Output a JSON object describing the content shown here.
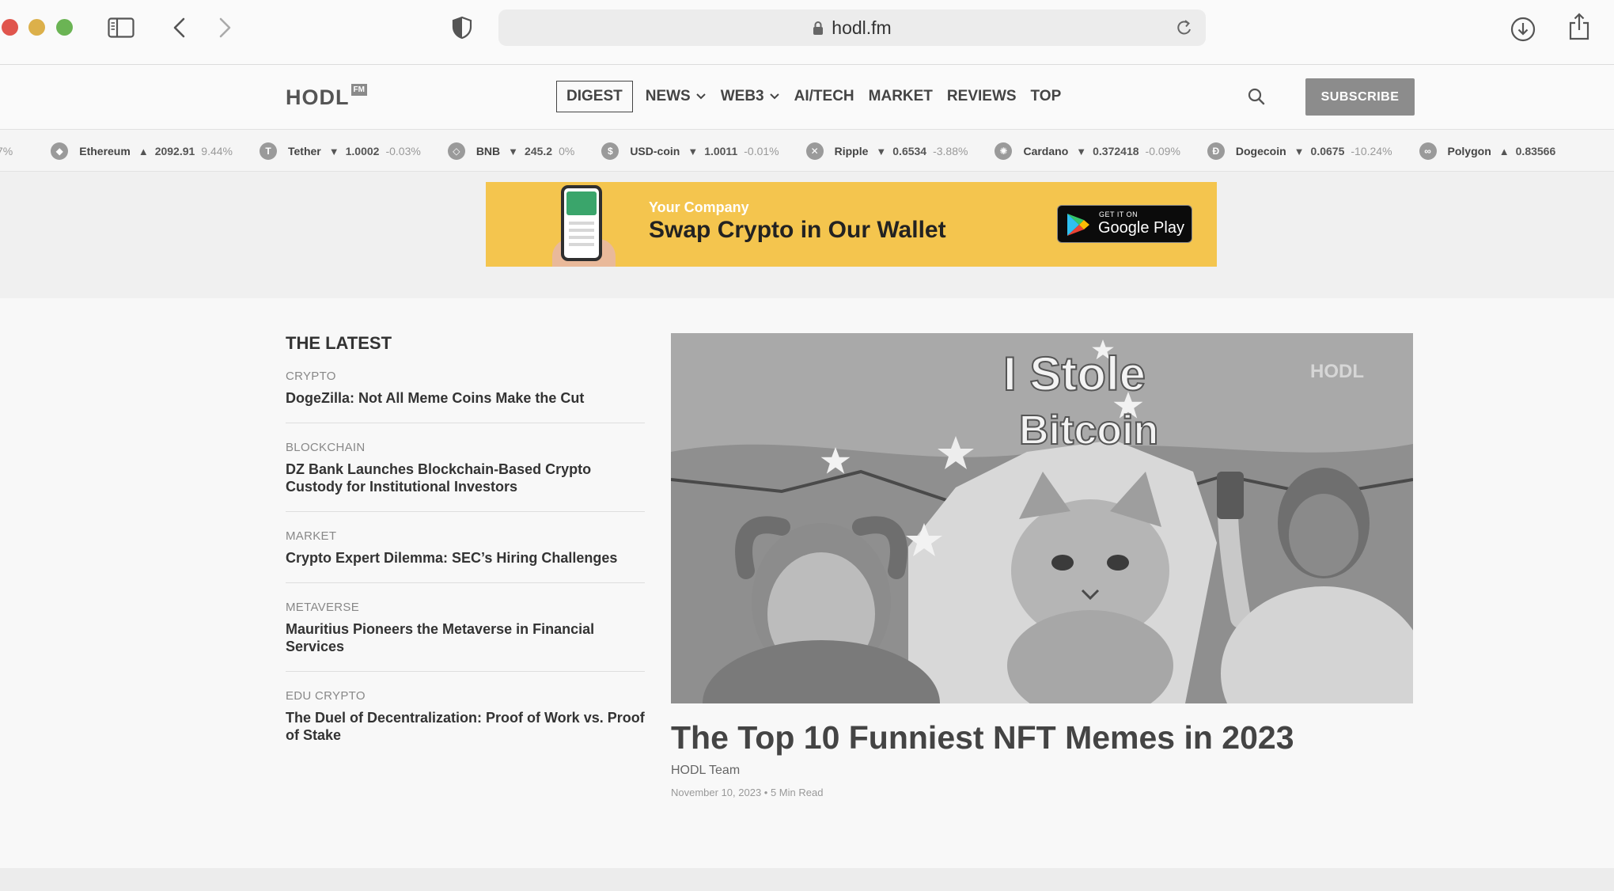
{
  "browser": {
    "url": "hodl.fm"
  },
  "site": {
    "logo_text": "HODL",
    "logo_badge": "FM",
    "nav": [
      {
        "label": "DIGEST"
      },
      {
        "label": "NEWS"
      },
      {
        "label": "WEB3"
      },
      {
        "label": "AI/TECH"
      },
      {
        "label": "MARKET"
      },
      {
        "label": "REVIEWS"
      },
      {
        "label": "TOP"
      }
    ],
    "subscribe_label": "SUBSCRIBE"
  },
  "ticker": {
    "leading_fragment": "7%",
    "items": [
      {
        "name": "Ethereum",
        "icon": "ethereum-icon",
        "glyph": "◆",
        "direction": "up",
        "arrow": "▲",
        "price": "2092.91",
        "change": "9.44%"
      },
      {
        "name": "Tether",
        "icon": "tether-icon",
        "glyph": "T",
        "direction": "down",
        "arrow": "▼",
        "price": "1.0002",
        "change": "-0.03%"
      },
      {
        "name": "BNB",
        "icon": "bnb-icon",
        "glyph": "◇",
        "direction": "down",
        "arrow": "▼",
        "price": "245.2",
        "change": "0%"
      },
      {
        "name": "USD-coin",
        "icon": "usd-coin-icon",
        "glyph": "$",
        "direction": "down",
        "arrow": "▼",
        "price": "1.0011",
        "change": "-0.01%"
      },
      {
        "name": "Ripple",
        "icon": "ripple-icon",
        "glyph": "✕",
        "direction": "down",
        "arrow": "▼",
        "price": "0.6534",
        "change": "-3.88%"
      },
      {
        "name": "Cardano",
        "icon": "cardano-icon",
        "glyph": "✺",
        "direction": "down",
        "arrow": "▼",
        "price": "0.372418",
        "change": "-0.09%"
      },
      {
        "name": "Dogecoin",
        "icon": "dogecoin-icon",
        "glyph": "Ð",
        "direction": "down",
        "arrow": "▼",
        "price": "0.0675",
        "change": "-10.24%"
      },
      {
        "name": "Polygon",
        "icon": "polygon-icon",
        "glyph": "∞",
        "direction": "up",
        "arrow": "▲",
        "price": "0.83566",
        "change": ""
      }
    ]
  },
  "ad": {
    "company": "Your Company",
    "title": "Swap Crypto in Our Wallet",
    "store_small": "GET IT ON",
    "store_big": "Google Play",
    "accent": "#f4c54e",
    "annotation_color": "#e33b2f"
  },
  "latest": {
    "heading": "THE LATEST",
    "items": [
      {
        "category": "CRYPTO",
        "headline": "DogeZilla: Not All Meme Coins Make the Cut"
      },
      {
        "category": "BLOCKCHAIN",
        "headline": "DZ Bank Launches Blockchain-Based Crypto Custody for Institutional Investors"
      },
      {
        "category": "MARKET",
        "headline": "Crypto Expert Dilemma: SEC’s Hiring Challenges"
      },
      {
        "category": "METAVERSE",
        "headline": "Mauritius Pioneers the Metaverse in Financial Services"
      },
      {
        "category": "EDU CRYPTO",
        "headline": "The Duel of Decentralization: Proof of Work vs. Proof of Stake"
      }
    ]
  },
  "featured": {
    "image_text_line1": "I Stole",
    "image_text_line2": "Bitcoin",
    "image_watermark": "HODL",
    "title": "The Top 10 Funniest NFT Memes in 2023",
    "author": "HODL Team",
    "meta": "November 10, 2023 • 5 Min Read"
  }
}
